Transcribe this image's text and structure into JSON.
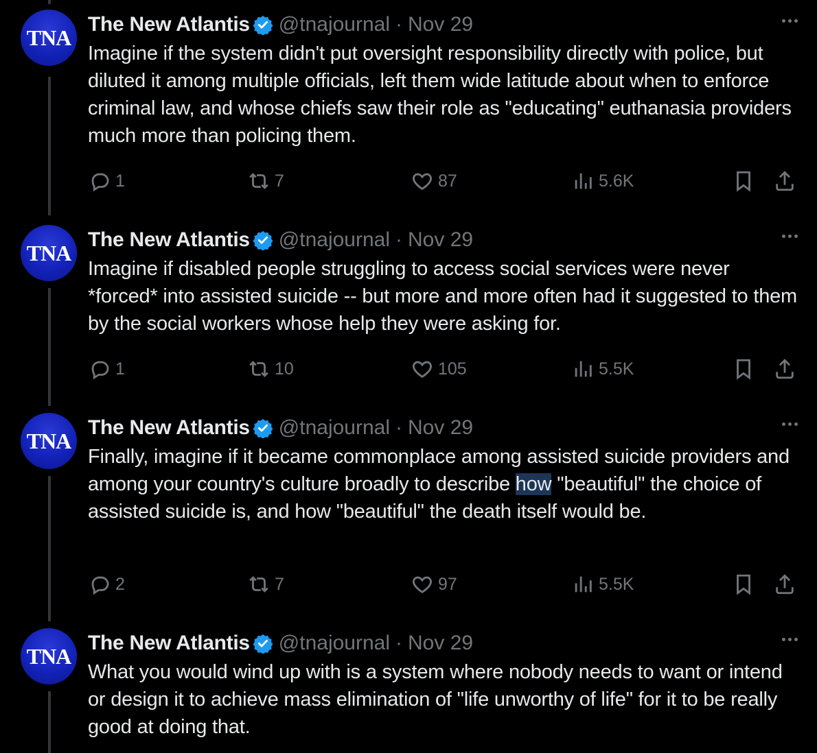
{
  "tweets": [
    {
      "author": "The New Atlantis",
      "handle": "@tnajournal",
      "separator": "·",
      "date": "Nov 29",
      "avatar_text": "TNA",
      "text": "Imagine if the system didn't put oversight responsibility directly with police, but diluted it among multiple officials, left them wide latitude about when to enforce criminal law, and whose chiefs saw their role as \"educating\" euthanasia providers much more than policing them.",
      "replies": "1",
      "reposts": "7",
      "likes": "87",
      "views": "5.6K"
    },
    {
      "author": "The New Atlantis",
      "handle": "@tnajournal",
      "separator": "·",
      "date": "Nov 29",
      "avatar_text": "TNA",
      "text": "Imagine if disabled people struggling to access social services were never *forced* into assisted suicide -- but more and more often had it suggested to them by the social workers whose help they were asking for.",
      "replies": "1",
      "reposts": "10",
      "likes": "105",
      "views": "5.5K"
    },
    {
      "author": "The New Atlantis",
      "handle": "@tnajournal",
      "separator": "·",
      "date": "Nov 29",
      "avatar_text": "TNA",
      "text_before": "Finally, imagine if it became commonplace among assisted suicide providers and among your country's culture broadly to describe ",
      "text_highlight": "how",
      "text_after": " \"beautiful\" the choice of assisted suicide is, and how \"beautiful\" the death itself would be.",
      "replies": "2",
      "reposts": "7",
      "likes": "97",
      "views": "5.5K"
    },
    {
      "author": "The New Atlantis",
      "handle": "@tnajournal",
      "separator": "·",
      "date": "Nov 29",
      "avatar_text": "TNA",
      "text": "What you would wind up with is a system where nobody needs to want or intend or design it to achieve mass elimination of \"life unworthy of life\" for it to be really good at doing that."
    }
  ],
  "colors": {
    "background": "#000000",
    "text": "#e7e9ea",
    "muted": "#71767b",
    "verified": "#1d9bf0",
    "avatar": "#1322b8",
    "selection": "#1d3557"
  },
  "icons": [
    "verified-badge-icon",
    "more-icon",
    "reply-icon",
    "repost-icon",
    "like-icon",
    "views-icon",
    "bookmark-icon",
    "share-icon"
  ]
}
